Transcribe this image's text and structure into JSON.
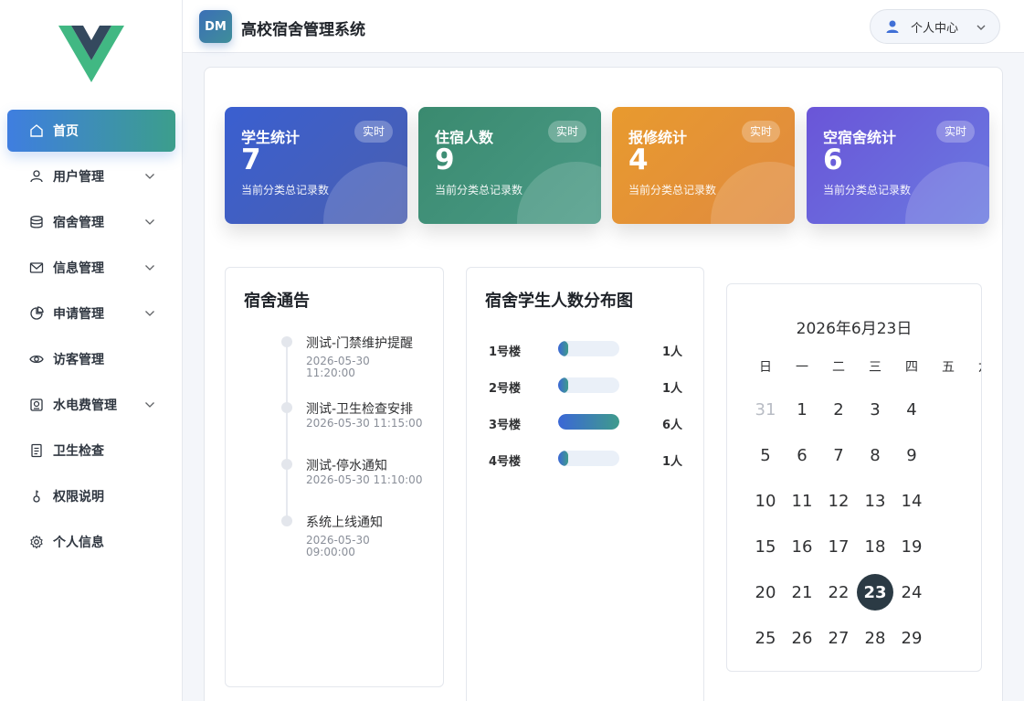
{
  "header": {
    "badge": "DM",
    "title": "高校宿舍管理系统",
    "user_label": "个人中心"
  },
  "sidebar": {
    "items": [
      {
        "label": "首页",
        "icon": "home-icon",
        "expandable": false,
        "active": true
      },
      {
        "label": "用户管理",
        "icon": "user-icon",
        "expandable": true
      },
      {
        "label": "宿舍管理",
        "icon": "database-icon",
        "expandable": true
      },
      {
        "label": "信息管理",
        "icon": "mail-icon",
        "expandable": true
      },
      {
        "label": "申请管理",
        "icon": "pie-chart-icon",
        "expandable": true
      },
      {
        "label": "访客管理",
        "icon": "eye-icon",
        "expandable": false
      },
      {
        "label": "水电费管理",
        "icon": "meter-icon",
        "expandable": true
      },
      {
        "label": "卫生检查",
        "icon": "document-icon",
        "expandable": false
      },
      {
        "label": "权限说明",
        "icon": "key-icon",
        "expandable": false
      },
      {
        "label": "个人信息",
        "icon": "gear-icon",
        "expandable": false
      }
    ]
  },
  "stats": [
    {
      "title": "学生统计",
      "tag": "实时",
      "value": "7",
      "sub": "当前分类总记录数",
      "color_from": "#3a5fd0",
      "color_to": "#4a5fb0"
    },
    {
      "title": "住宿人数",
      "tag": "实时",
      "value": "9",
      "sub": "当前分类总记录数",
      "color_from": "#3a8a6f",
      "color_to": "#4a9a86"
    },
    {
      "title": "报修统计",
      "tag": "实时",
      "value": "4",
      "sub": "当前分类总记录数",
      "color_from": "#e89a2e",
      "color_to": "#e08a40"
    },
    {
      "title": "空宿舍统计",
      "tag": "实时",
      "value": "6",
      "sub": "当前分类总记录数",
      "color_from": "#6a55d8",
      "color_to": "#6a7ae0"
    }
  ],
  "notices": {
    "title": "宿舍通告",
    "items": [
      {
        "text": "测试-门禁维护提醒",
        "time": "2026-05-30 11:20:00"
      },
      {
        "text": "测试-卫生检查安排",
        "time": "2026-05-30 11:15:00"
      },
      {
        "text": "测试-停水通知",
        "time": "2026-05-30 11:10:00"
      },
      {
        "text": "系统上线通知",
        "time": "2026-05-30 09:00:00"
      }
    ]
  },
  "distribution": {
    "title": "宿舍学生人数分布图",
    "rows": [
      {
        "label": "1号楼",
        "count": 1,
        "count_label": "1人"
      },
      {
        "label": "2号楼",
        "count": 1,
        "count_label": "1人"
      },
      {
        "label": "3号楼",
        "count": 6,
        "count_label": "6人"
      },
      {
        "label": "4号楼",
        "count": 1,
        "count_label": "1人"
      }
    ],
    "max": 6
  },
  "calendar": {
    "title": "2026年6月23日",
    "weekdays": [
      "日",
      "一",
      "二",
      "三",
      "四",
      "五",
      "六"
    ],
    "weeks": [
      [
        "31",
        "1",
        "2",
        "3",
        "4",
        "5",
        "6"
      ],
      [
        "7",
        "8",
        "9",
        "10",
        "11",
        "12",
        "13"
      ],
      [
        "14",
        "15",
        "16",
        "17",
        "18",
        "19",
        "20"
      ],
      [
        "21",
        "22",
        "23",
        "24",
        "25",
        "26",
        "27"
      ],
      [
        "28",
        "29",
        "30",
        "1",
        "2",
        "3",
        "4"
      ],
      [
        "5",
        "6",
        "7",
        "8",
        "9",
        "10",
        "11"
      ]
    ],
    "visible_weeks": [
      [
        "31",
        "1",
        "2",
        "3",
        "4"
      ],
      [
        "5",
        "6",
        "7",
        "8",
        "9"
      ],
      [
        "10",
        "11",
        "12",
        "13",
        "14"
      ],
      [
        "15",
        "16",
        "17",
        "18",
        "19"
      ],
      [
        "20",
        "21",
        "22",
        "23",
        "24"
      ],
      [
        "25",
        "26",
        "27",
        "28",
        "29"
      ]
    ],
    "today": "23",
    "muted": [
      "31"
    ]
  }
}
